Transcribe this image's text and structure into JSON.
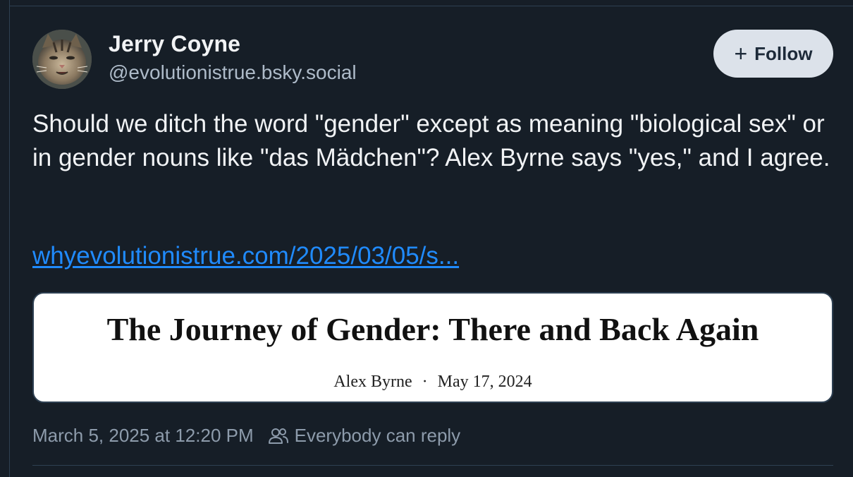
{
  "post": {
    "author_name": "Jerry Coyne",
    "author_handle": "@evolutionistrue.bsky.social",
    "follow_label": "Follow",
    "follow_icon": "plus-icon",
    "text": "Should we ditch the word \"gender\" except as meaning \"biological sex\" or in gender nouns like \"das Mädchen\"? Alex Byrne says \"yes,\" and I agree.",
    "link_text": "whyevolutionistrue.com/2025/03/05/s...",
    "embed": {
      "title": "The Journey of Gender: There and Back Again",
      "author": "Alex Byrne",
      "separator": "·",
      "date": "May 17, 2024"
    },
    "timestamp": "March 5, 2025 at 12:20 PM",
    "reply_setting": "Everybody can reply",
    "reply_icon": "people-icon"
  },
  "colors": {
    "background": "#161e27",
    "link": "#208bfe",
    "muted_text": "#8d9bab",
    "follow_button_bg": "#dce2ea"
  }
}
